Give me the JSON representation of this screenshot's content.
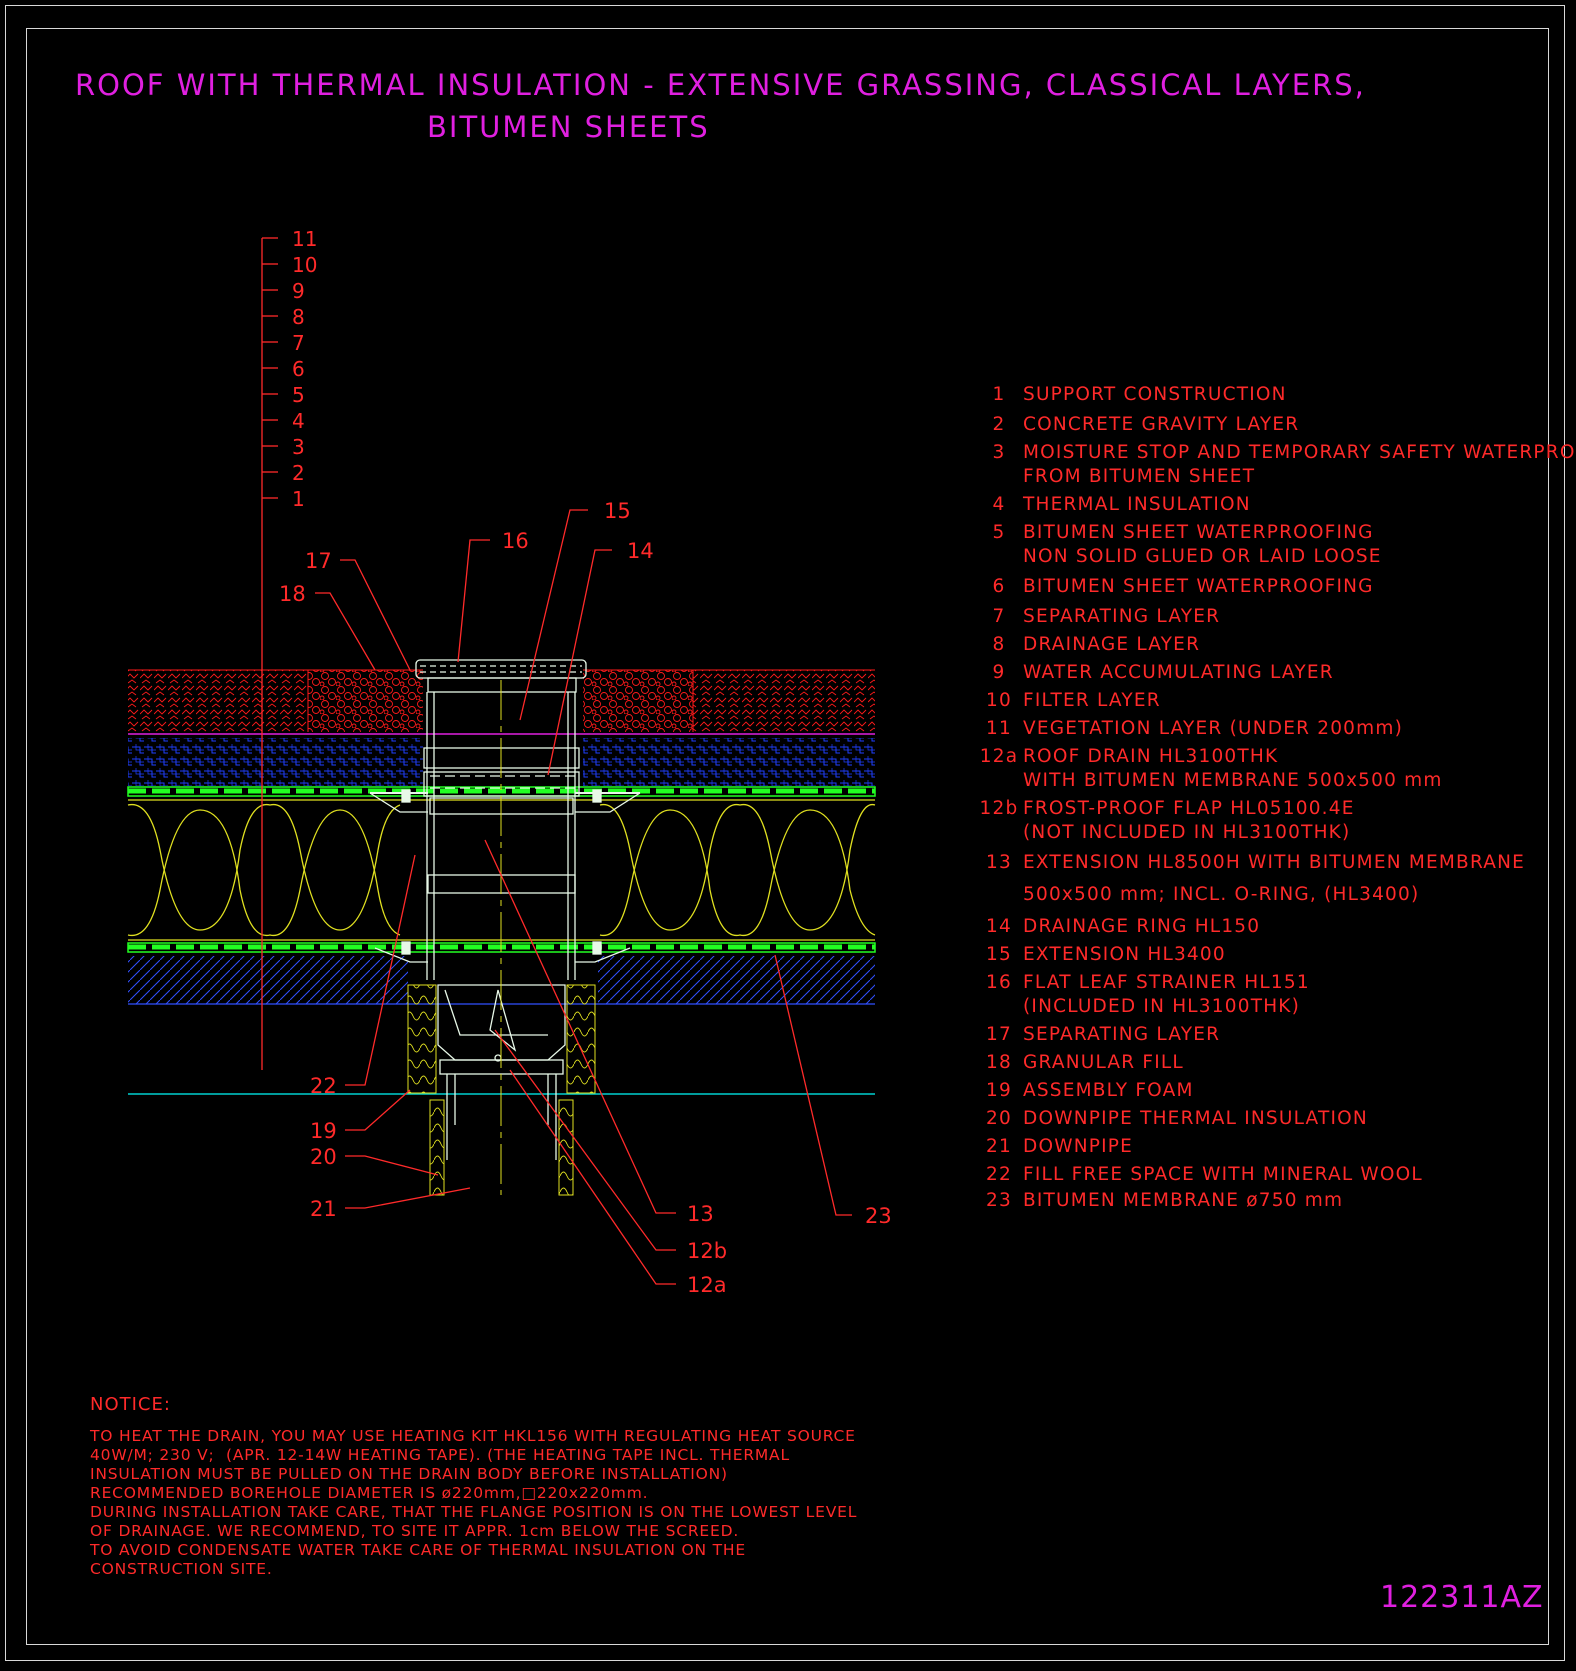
{
  "title": {
    "line1": "ROOF WITH THERMAL INSULATION - EXTENSIVE GRASSING, CLASSICAL LAYERS,",
    "line2": "BITUMEN SHEETS"
  },
  "layer_scale": [
    "11",
    "10",
    "9",
    "8",
    "7",
    "6",
    "5",
    "4",
    "3",
    "2",
    "1"
  ],
  "callouts": {
    "c15": "15",
    "c16": "16",
    "c14": "14",
    "c17": "17",
    "c18": "18",
    "c22": "22",
    "c19": "19",
    "c20": "20",
    "c21": "21",
    "c13": "13",
    "c12b": "12b",
    "c12a": "12a",
    "c23": "23"
  },
  "legend": [
    {
      "no": "1",
      "lines": [
        "SUPPORT CONSTRUCTION"
      ]
    },
    {
      "no": "2",
      "lines": [
        "CONCRETE GRAVITY LAYER"
      ]
    },
    {
      "no": "3",
      "lines": [
        "MOISTURE STOP AND TEMPORARY SAFETY WATERPROOFING",
        "FROM BITUMEN SHEET"
      ]
    },
    {
      "no": "4",
      "lines": [
        "THERMAL INSULATION"
      ]
    },
    {
      "no": "5",
      "lines": [
        "BITUMEN SHEET WATERPROOFING",
        "NON SOLID GLUED OR LAID LOOSE"
      ]
    },
    {
      "no": "6",
      "lines": [
        "BITUMEN SHEET WATERPROOFING"
      ]
    },
    {
      "no": "7",
      "lines": [
        "SEPARATING LAYER"
      ]
    },
    {
      "no": "8",
      "lines": [
        "DRAINAGE LAYER"
      ]
    },
    {
      "no": "9",
      "lines": [
        "WATER ACCUMULATING LAYER"
      ]
    },
    {
      "no": "10",
      "lines": [
        "FILTER LAYER"
      ]
    },
    {
      "no": "11",
      "lines": [
        "VEGETATION LAYER (UNDER 200mm)"
      ]
    },
    {
      "no": "12a",
      "lines": [
        "ROOF DRAIN HL3100THK",
        "WITH BITUMEN MEMBRANE 500x500 mm"
      ]
    },
    {
      "no": "12b",
      "lines": [
        "FROST-PROOF FLAP HL05100.4E",
        "(NOT INCLUDED IN HL3100THK)"
      ]
    },
    {
      "no": "13",
      "lines": [
        "EXTENSION HL8500H WITH BITUMEN MEMBRANE",
        "500x500 mm; INCL. O-RING, (HL3400)"
      ]
    },
    {
      "no": "14",
      "lines": [
        "DRAINAGE RING HL150"
      ]
    },
    {
      "no": "15",
      "lines": [
        "EXTENSION HL3400"
      ]
    },
    {
      "no": "16",
      "lines": [
        "FLAT LEAF STRAINER HL151",
        "(INCLUDED IN HL3100THK)"
      ]
    },
    {
      "no": "17",
      "lines": [
        "SEPARATING LAYER"
      ]
    },
    {
      "no": "18",
      "lines": [
        "GRANULAR FILL"
      ]
    },
    {
      "no": "19",
      "lines": [
        "ASSEMBLY FOAM"
      ]
    },
    {
      "no": "20",
      "lines": [
        "DOWNPIPE THERMAL INSULATION"
      ]
    },
    {
      "no": "21",
      "lines": [
        "DOWNPIPE"
      ]
    },
    {
      "no": "22",
      "lines": [
        "FILL FREE SPACE WITH MINERAL WOOL"
      ]
    },
    {
      "no": "23",
      "lines": [
        "BITUMEN MEMBRANE ø750 mm"
      ]
    }
  ],
  "notice": {
    "heading": "NOTICE:",
    "lines": [
      "TO HEAT THE DRAIN, YOU MAY USE HEATING KIT HKL156 WITH REGULATING HEAT SOURCE",
      "40W/M; 230 V;  (APR. 12-14W HEATING TAPE). (THE HEATING TAPE INCL. THERMAL",
      "INSULATION MUST BE PULLED ON THE DRAIN BODY BEFORE INSTALLATION)",
      "RECOMMENDED BOREHOLE DIAMETER IS ø220mm,□220x220mm.",
      "DURING INSTALLATION TAKE CARE, THAT THE FLANGE POSITION IS ON THE LOWEST LEVEL",
      "OF DRAINAGE. WE RECOMMEND, TO SITE IT APPR. 1cm BELOW THE SCREED.",
      "TO AVOID CONDENSATE WATER TAKE CARE OF THERMAL INSULATION ON THE",
      "CONSTRUCTION SITE."
    ]
  },
  "drawing_code": "122311AZ",
  "colors": {
    "title": "#e020e0",
    "annotation": "#ff2a2a",
    "frame": "#d8d8d8",
    "gravel": "#ff1a1a",
    "drainage": "#2040ff",
    "membrane": "#22ff22",
    "insulation": "#e0e020",
    "concrete": "#3050ff",
    "drain": "#e8f8e8",
    "support_line": "#00d0d0"
  }
}
